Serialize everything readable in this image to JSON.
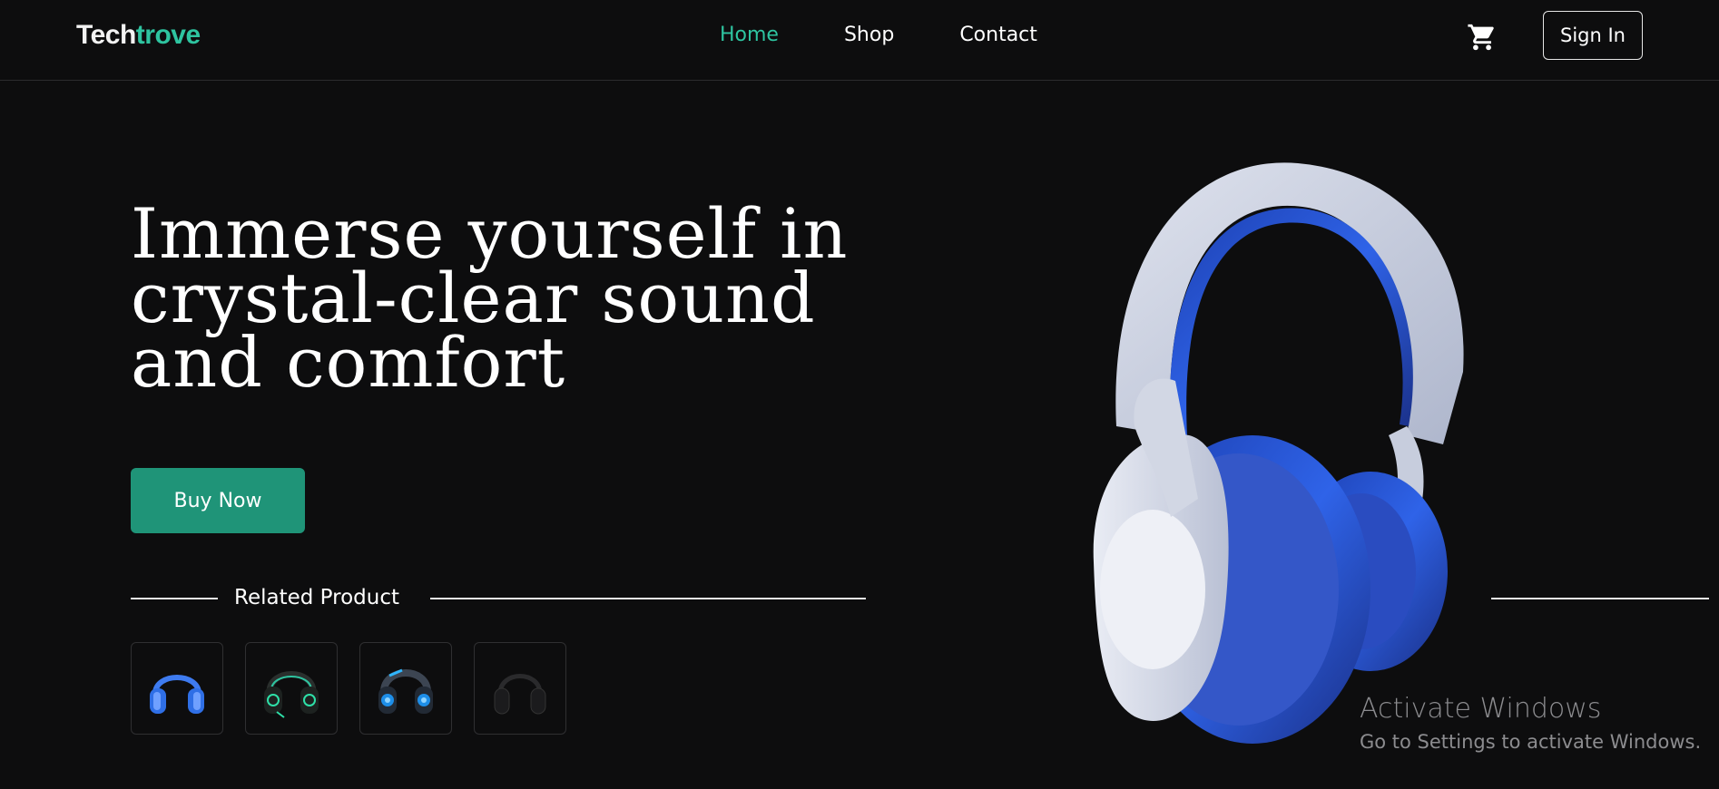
{
  "header": {
    "logo": {
      "part1": "Tech",
      "part2": "trove"
    },
    "nav": [
      "Home",
      "Shop",
      "Contact"
    ],
    "active_nav": "Home",
    "cart_icon": "cart-icon",
    "signin_label": "Sign In"
  },
  "hero": {
    "headline_lines": [
      "Immerse yourself in",
      "crystal-clear sound",
      "and comfort"
    ],
    "cta_label": "Buy Now",
    "related_label": "Related Product",
    "related_products": [
      {
        "icon": "blue-headphones-icon"
      },
      {
        "icon": "green-gaming-headset-icon"
      },
      {
        "icon": "blue-gaming-headset-icon"
      },
      {
        "icon": "black-headphones-icon"
      }
    ],
    "product_image": "white-blue-headphones-image"
  },
  "watermark": {
    "title": "Activate Windows",
    "subtitle": "Go to Settings to activate Windows."
  },
  "colors": {
    "background": "#0d0d0e",
    "accent": "#2ec4a0",
    "button": "#1f9478",
    "product_blue": "#2b5fe0"
  }
}
